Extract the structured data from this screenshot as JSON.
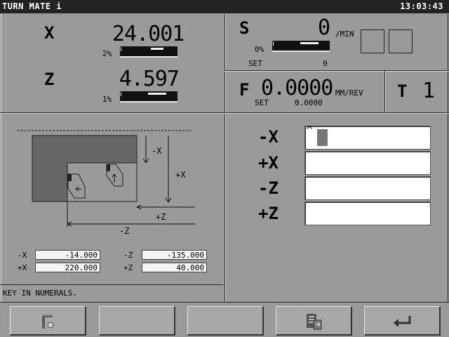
{
  "app": {
    "title": "TURN MATE i",
    "clock": "13:03:43"
  },
  "position": {
    "x": {
      "label": "X",
      "value": "24.001",
      "load": "2%",
      "load_fraction": 0.02
    },
    "z": {
      "label": "Z",
      "value": "4.597",
      "load": "1%",
      "load_fraction": 0.01
    }
  },
  "spindle": {
    "label": "S",
    "value": "0",
    "unit": "/MIN",
    "load": "0%",
    "load_fraction": 0.0,
    "set_label": "SET",
    "set_value": "0"
  },
  "feed": {
    "label": "F",
    "value": "0.0000",
    "unit": "MM/REV",
    "set_label": "SET",
    "set_value": "0.0000"
  },
  "tool": {
    "label": "T",
    "value": "1"
  },
  "diagram": {
    "labels": {
      "minus_x": "-X",
      "plus_x": "+X",
      "plus_z": "+Z",
      "minus_z": "-Z"
    },
    "limits": [
      {
        "axis": "-X",
        "value": "-14.000"
      },
      {
        "axis": "-Z",
        "value": "-135.000"
      },
      {
        "axis": "+X",
        "value": "220.000"
      },
      {
        "axis": "+Z",
        "value": "40.000"
      }
    ]
  },
  "inputs": [
    {
      "label": "-X",
      "value": ""
    },
    {
      "label": "+X",
      "value": ""
    },
    {
      "label": "-Z",
      "value": ""
    },
    {
      "label": "+Z",
      "value": ""
    }
  ],
  "message": "KEY IN NUMERALS.",
  "softkeys": [
    {
      "icon": "tool-setting-icon"
    },
    {
      "icon": "blank"
    },
    {
      "icon": "blank"
    },
    {
      "icon": "program-list-icon"
    },
    {
      "icon": "return-arrow-icon"
    }
  ]
}
